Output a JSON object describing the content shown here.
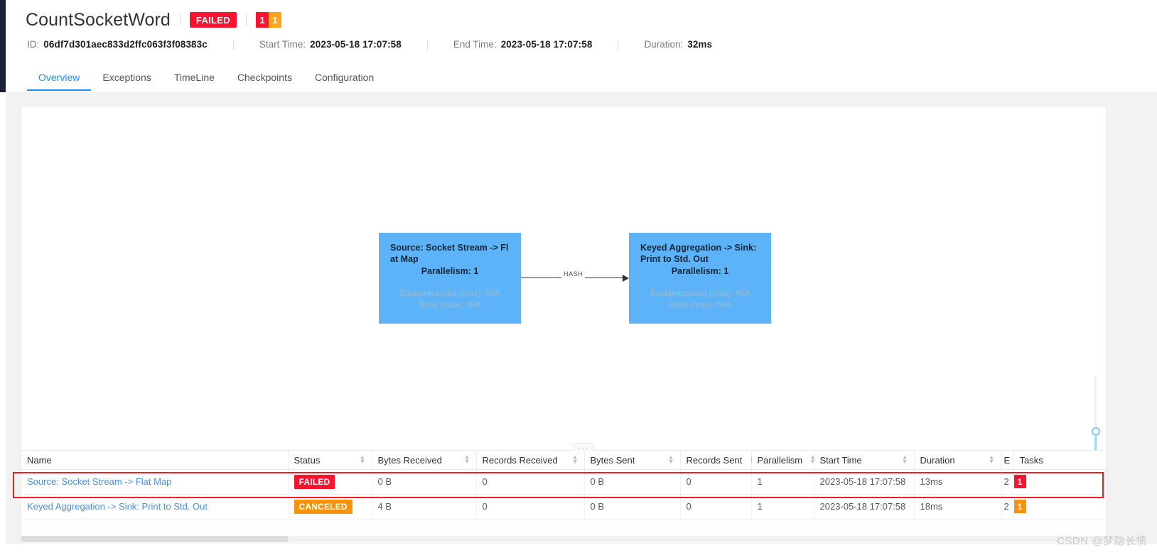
{
  "header": {
    "job_title": "CountSocketWord",
    "status_badge": "FAILED",
    "task_badge_red": "1",
    "task_badge_orange": "1",
    "meta": {
      "id_label": "ID:",
      "id_value": "06df7d301aec833d2ffc063f3f08383c",
      "start_label": "Start Time:",
      "start_value": "2023-05-18 17:07:58",
      "end_label": "End Time:",
      "end_value": "2023-05-18 17:07:58",
      "duration_label": "Duration:",
      "duration_value": "32ms"
    },
    "tabs": [
      {
        "label": "Overview",
        "active": true
      },
      {
        "label": "Exceptions",
        "active": false
      },
      {
        "label": "TimeLine",
        "active": false
      },
      {
        "label": "Checkpoints",
        "active": false
      },
      {
        "label": "Configuration",
        "active": false
      }
    ]
  },
  "graph": {
    "nodes": [
      {
        "title": "Source: Socket Stream -> Flat Map",
        "parallelism": "Parallelism: 1",
        "backpressured": "Backpressured (max): N/A",
        "busy": "Busy (max): N/A"
      },
      {
        "title": "Keyed Aggregation -> Sink: Print to Std. Out",
        "parallelism": "Parallelism: 1",
        "backpressured": "Backpressured (max): N/A",
        "busy": "Busy (max): N/A"
      }
    ],
    "edge_label": "HASH",
    "splitter_handle": "···"
  },
  "table": {
    "columns": [
      "Name",
      "Status",
      "Bytes Received",
      "Records Received",
      "Bytes Sent",
      "Records Sent",
      "Parallelism",
      "Start Time",
      "Duration",
      "E",
      "Tasks"
    ],
    "rows": [
      {
        "name": "Source: Socket Stream -> Flat Map",
        "status": "FAILED",
        "status_kind": "failed",
        "bytes_received": "0 B",
        "records_received": "0",
        "bytes_sent": "0 B",
        "records_sent": "0",
        "parallelism": "1",
        "start_time": "2023-05-18 17:07:58",
        "duration": "13ms",
        "e": "2",
        "tasks_count": "1",
        "tasks_kind": "red"
      },
      {
        "name": "Keyed Aggregation -> Sink: Print to Std. Out",
        "status": "CANCELED",
        "status_kind": "canceled",
        "bytes_received": "4 B",
        "records_received": "0",
        "bytes_sent": "0 B",
        "records_sent": "0",
        "parallelism": "1",
        "start_time": "2023-05-18 17:07:58",
        "duration": "18ms",
        "e": "2",
        "tasks_count": "1",
        "tasks_kind": "orange"
      }
    ]
  },
  "watermark": "CSDN @梦隐长情",
  "colors": {
    "accent": "#1890ff",
    "failed": "#fb1430",
    "canceled": "#f7920a",
    "node": "#5cb3f7",
    "highlight_box": "#f51b1b"
  }
}
